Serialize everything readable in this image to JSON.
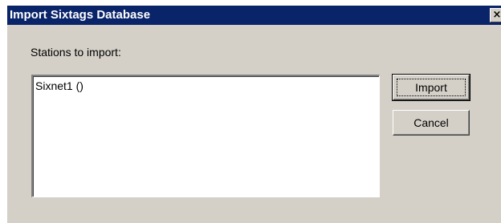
{
  "window": {
    "title": "Import Sixtags Database",
    "close_glyph": "×"
  },
  "stations": {
    "label": "Stations to import:",
    "items": [
      "Sixnet1 ()"
    ]
  },
  "buttons": {
    "import_label": "Import",
    "cancel_label": "Cancel"
  },
  "colors": {
    "titlebar": "#0a246a",
    "dialog_face": "#d4d0c8",
    "list_background": "#ffffff"
  }
}
